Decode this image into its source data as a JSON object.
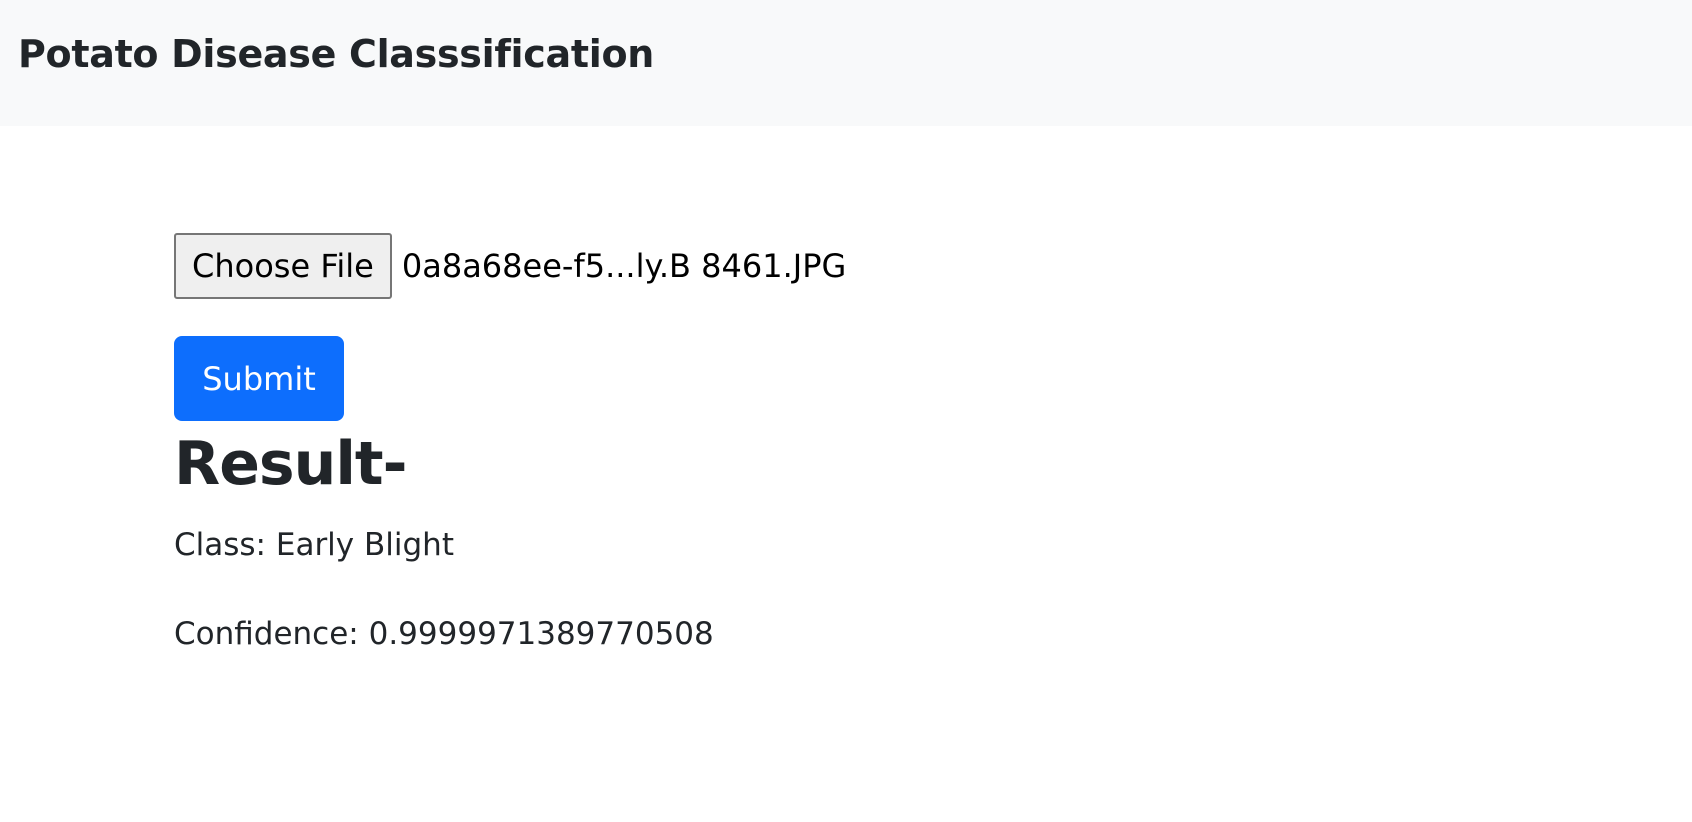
{
  "navbar": {
    "brand": "Potato Disease Classsification"
  },
  "upload": {
    "choose_file_label": "Choose File",
    "selected_file": "0a8a68ee-f5...ly.B 8461.JPG",
    "submit_label": "Submit"
  },
  "result": {
    "heading": "Result-",
    "class_line": "Class: Early Blight",
    "confidence_line": "Confidence: 0.9999971389770508"
  },
  "colors": {
    "navbar_bg": "#f8f9fa",
    "submit_bg": "#0d6efd",
    "text": "#212529"
  }
}
